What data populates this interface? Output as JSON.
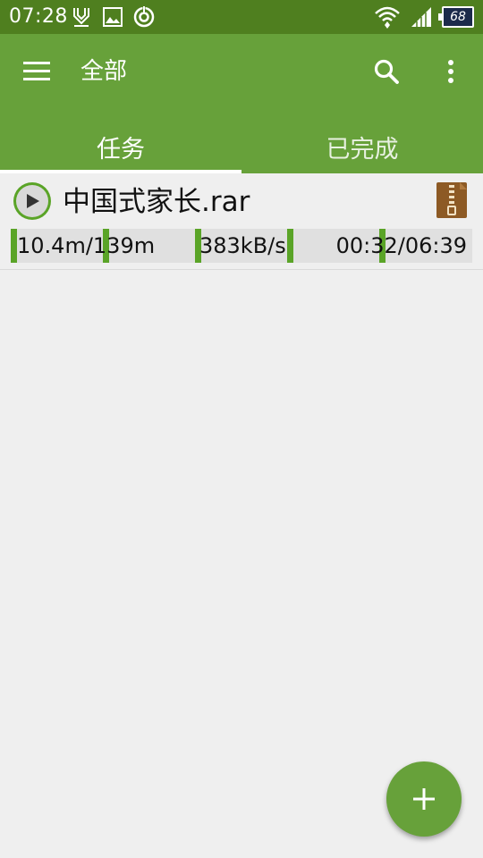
{
  "status_bar": {
    "time": "07:28",
    "battery_level": "68",
    "icons": [
      "download-notification-icon",
      "image-notification-icon",
      "sync-notification-icon",
      "wifi-icon",
      "signal-icon",
      "battery-icon"
    ]
  },
  "app_bar": {
    "title": "全部",
    "tabs": [
      {
        "label": "任务",
        "active": true
      },
      {
        "label": "已完成",
        "active": false
      }
    ],
    "colors": {
      "app_bar": "#67a13a",
      "status_bar": "#4f7f1f",
      "accent": "#5aa427"
    }
  },
  "tasks": [
    {
      "name": "中国式家长.rar",
      "file_type_icon": "archive-icon",
      "downloaded": "10.4m/139m",
      "speed": "383kB/s",
      "time": "00:32/06:39",
      "status": "paused"
    }
  ],
  "fab": {
    "icon": "plus-icon"
  }
}
